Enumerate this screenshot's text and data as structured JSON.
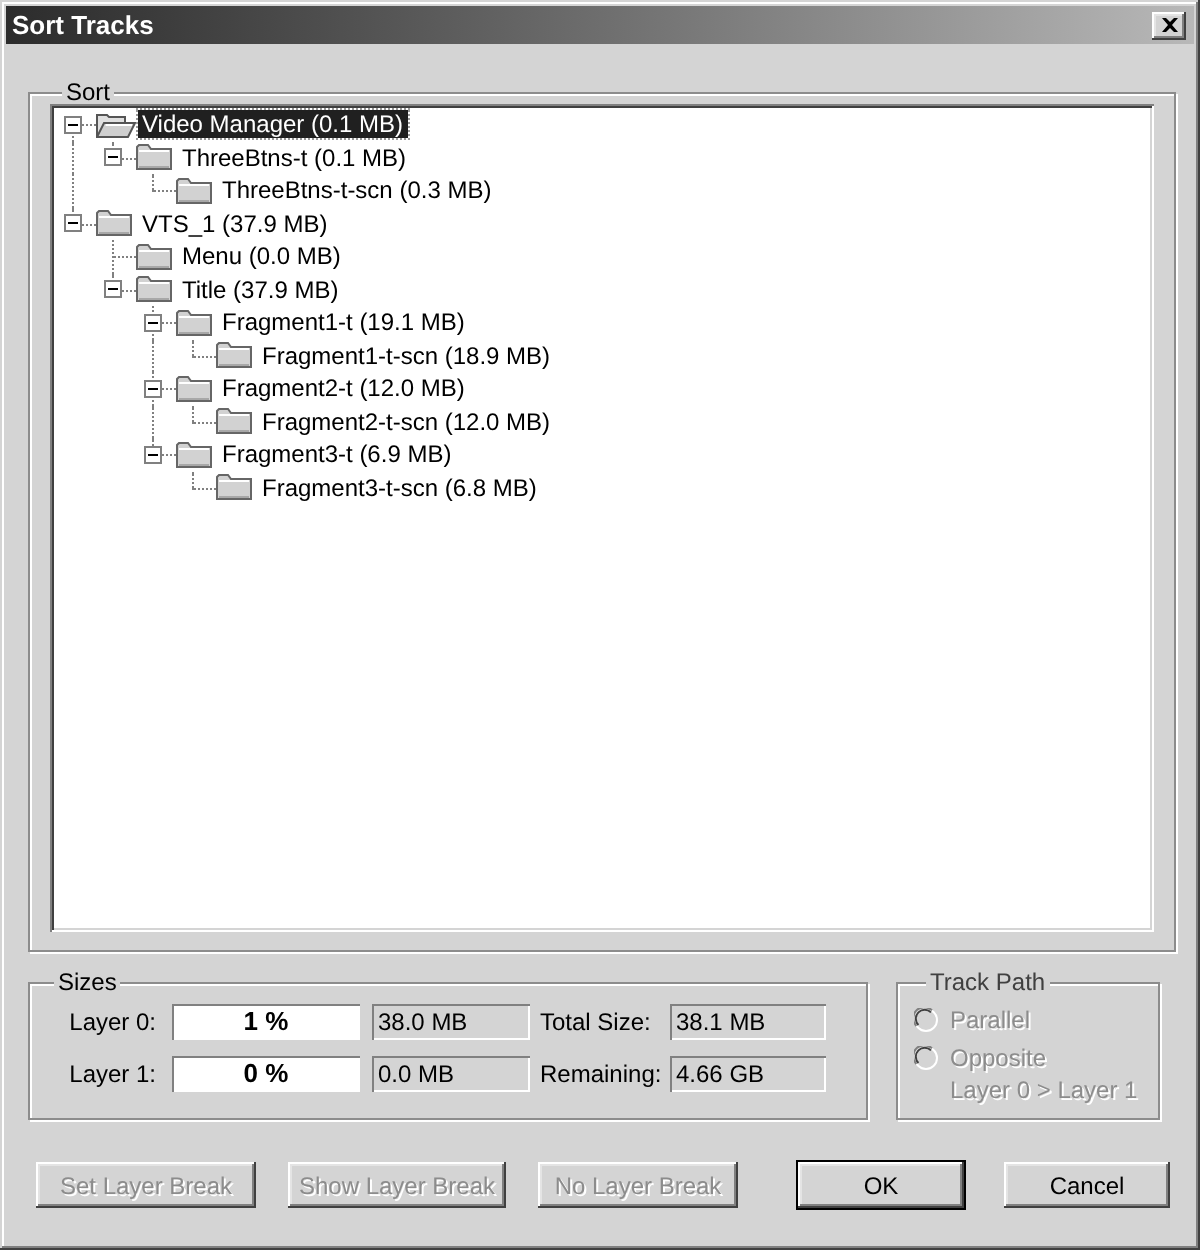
{
  "window": {
    "title": "Sort Tracks"
  },
  "sort": {
    "label": "Sort",
    "tree": [
      {
        "label": "Video Manager (0.1 MB)",
        "selected": true,
        "expanded": true,
        "children": [
          {
            "label": "ThreeBtns-t (0.1 MB)",
            "selected": false,
            "expanded": true,
            "children": [
              {
                "label": "ThreeBtns-t-scn (0.3 MB)",
                "selected": false
              }
            ]
          }
        ]
      },
      {
        "label": "VTS_1 (37.9 MB)",
        "selected": false,
        "expanded": true,
        "children": [
          {
            "label": "Menu (0.0 MB)",
            "selected": false
          },
          {
            "label": "Title (37.9 MB)",
            "selected": false,
            "expanded": true,
            "children": [
              {
                "label": "Fragment1-t (19.1 MB)",
                "selected": false,
                "expanded": true,
                "children": [
                  {
                    "label": "Fragment1-t-scn (18.9 MB)",
                    "selected": false
                  }
                ]
              },
              {
                "label": "Fragment2-t (12.0 MB)",
                "selected": false,
                "expanded": true,
                "children": [
                  {
                    "label": "Fragment2-t-scn (12.0 MB)",
                    "selected": false
                  }
                ]
              },
              {
                "label": "Fragment3-t (6.9 MB)",
                "selected": false,
                "expanded": true,
                "children": [
                  {
                    "label": "Fragment3-t-scn (6.8 MB)",
                    "selected": false
                  }
                ]
              }
            ]
          }
        ]
      }
    ]
  },
  "sizes": {
    "label": "Sizes",
    "rows": [
      {
        "label": "Layer 0:",
        "percent": "1 %",
        "size": "38.0 MB",
        "total_label": "Total Size:",
        "total_value": "38.1 MB"
      },
      {
        "label": "Layer 1:",
        "percent": "0 %",
        "size": "0.0 MB",
        "total_label": "Remaining:",
        "total_value": "4.66 GB"
      }
    ]
  },
  "track_path": {
    "label": "Track Path",
    "options": [
      {
        "label": "Parallel",
        "selected": false,
        "disabled": true
      },
      {
        "label": "Opposite",
        "selected": false,
        "disabled": true
      }
    ],
    "note": {
      "text": "Layer 0 > Layer 1",
      "disabled": true
    }
  },
  "layer_buttons": [
    {
      "label": "Set Layer Break",
      "disabled": true
    },
    {
      "label": "Show Layer Break",
      "disabled": true
    },
    {
      "label": "No Layer Break",
      "disabled": true
    }
  ],
  "dialog_buttons": [
    {
      "label": "OK",
      "disabled": false,
      "default": true
    },
    {
      "label": "Cancel",
      "disabled": false,
      "default": false
    }
  ]
}
